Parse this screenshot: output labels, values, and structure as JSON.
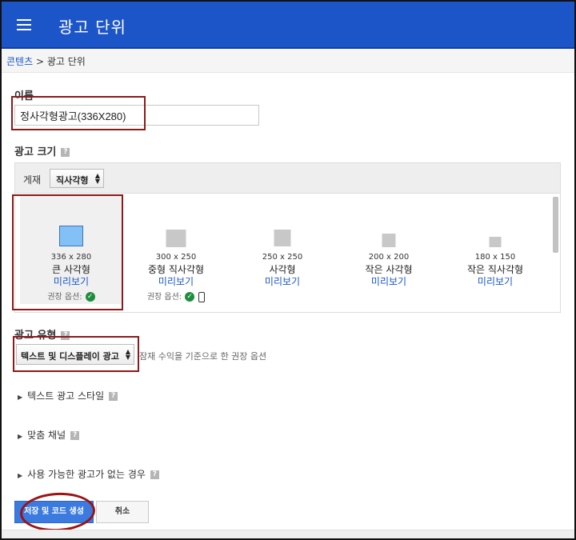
{
  "header": {
    "title": "광고 단위",
    "menu_icon": "hamburger-menu-icon"
  },
  "breadcrumb": {
    "parent": "콘텐츠",
    "separator": ">",
    "current": "광고 단위"
  },
  "name_section": {
    "label": "이름",
    "value": "정사각형광고(336X280)"
  },
  "size_section": {
    "label": "광고 크기",
    "help": "?",
    "placement_label": "게재",
    "placement_value": "직사각형",
    "options": [
      {
        "dims": "336 x 280",
        "name": "큰 사각형",
        "preview": "미리보기",
        "recommended": "권장 옵션:",
        "selected": true,
        "mobile": false
      },
      {
        "dims": "300 x 250",
        "name": "중형 직사각형",
        "preview": "미리보기",
        "recommended": "권장 옵션:",
        "selected": false,
        "mobile": true
      },
      {
        "dims": "250 x 250",
        "name": "사각형",
        "preview": "미리보기",
        "recommended": "",
        "selected": false,
        "mobile": false
      },
      {
        "dims": "200 x 200",
        "name": "작은 사각형",
        "preview": "미리보기",
        "recommended": "",
        "selected": false,
        "mobile": false
      },
      {
        "dims": "180 x 150",
        "name": "작은 직사각형",
        "preview": "미리보기",
        "recommended": "",
        "selected": false,
        "mobile": false
      }
    ]
  },
  "type_section": {
    "label": "광고 유형",
    "help": "?",
    "value": "텍스트 및 디스플레이 광고",
    "hint": "잠재 수익을 기준으로 한 권장 옵션"
  },
  "expanders": [
    {
      "label": "텍스트 광고 스타일",
      "help": "?"
    },
    {
      "label": "맞춤 채널",
      "help": "?"
    },
    {
      "label": "사용 가능한 광고가 없는 경우",
      "help": "?"
    }
  ],
  "actions": {
    "save_label": "저장 및 코드 생성",
    "cancel_label": "취소"
  },
  "colors": {
    "header": "#1c55c8",
    "link": "#1a55c8",
    "primary_button": "#3b7be0",
    "annotation": "#8b1a1a",
    "check": "#1e8e3e"
  }
}
